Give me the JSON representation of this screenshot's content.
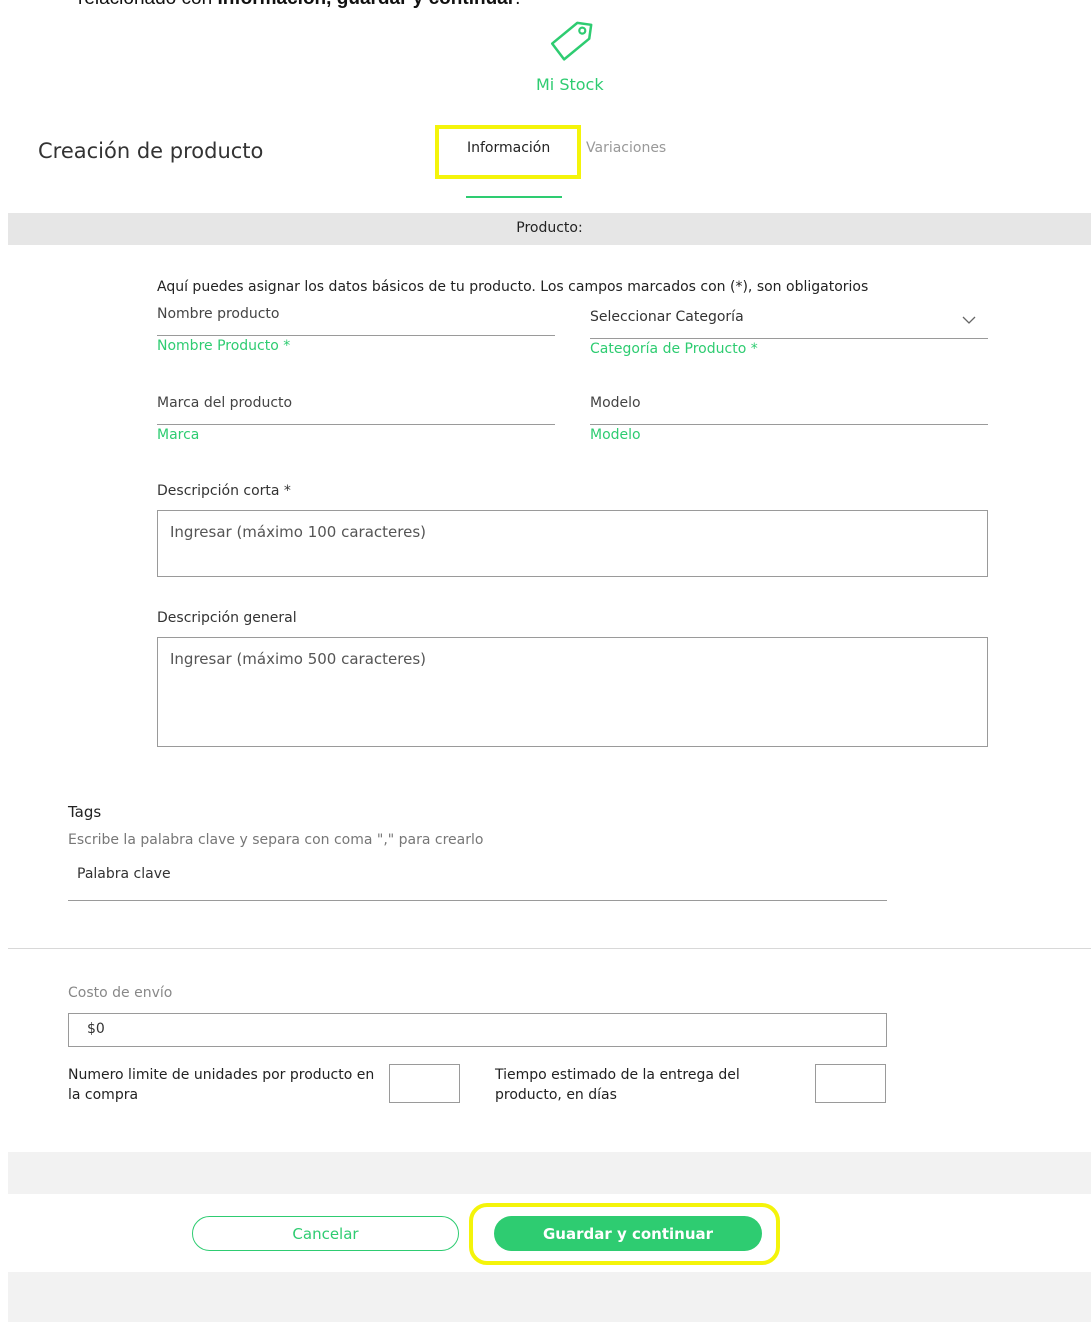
{
  "caption": {
    "prefix": "relacionado con ",
    "bold": "Información, guardar y continuar",
    "suffix": "."
  },
  "header": {
    "icon": "tag-icon",
    "stock_label": "Mi Stock",
    "page_title": "Creación de producto",
    "tabs": [
      {
        "label": "Información",
        "active": true
      },
      {
        "label": "Variaciones",
        "active": false
      }
    ]
  },
  "section": {
    "title": "Producto:",
    "intro": "Aquí puedes asignar los datos básicos de tu producto. Los campos marcados con (*), son obligatorios"
  },
  "fields": {
    "name": {
      "placeholder": "Nombre producto",
      "hint": "Nombre Producto *"
    },
    "category": {
      "placeholder": "Seleccionar Categoría",
      "hint": "Categoría de Producto *"
    },
    "brand": {
      "placeholder": "Marca del producto",
      "hint": "Marca"
    },
    "model": {
      "placeholder": "Modelo",
      "hint": "Modelo"
    },
    "short_desc": {
      "label": "Descripción corta *",
      "placeholder": "Ingresar (máximo 100 caracteres)"
    },
    "general_desc": {
      "label": "Descripción general",
      "placeholder": "Ingresar (máximo 500 caracteres)"
    }
  },
  "tags": {
    "title": "Tags",
    "help": "Escribe la palabra clave y separa con coma \",\" para crearlo",
    "placeholder": "Palabra clave"
  },
  "shipping": {
    "label": "Costo de envío",
    "value": "$0",
    "units_label": "Numero limite de unidades por producto en la compra",
    "delivery_label": "Tiempo estimado de la entrega del producto, en días"
  },
  "actions": {
    "cancel": "Cancelar",
    "save": "Guardar y continuar"
  },
  "colors": {
    "accent": "#2ecc71",
    "highlight": "#f4f40a"
  }
}
